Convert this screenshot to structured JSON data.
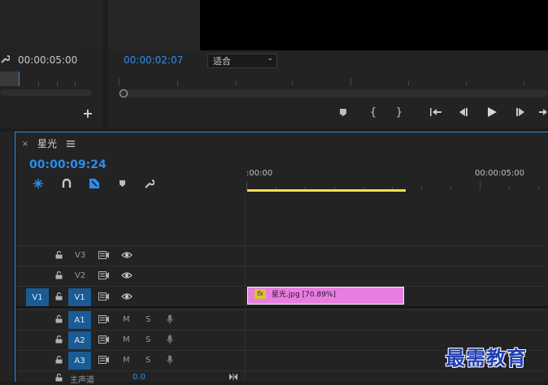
{
  "source_monitor": {
    "timecode": "00:00:05:00",
    "add_icon": "plus-icon"
  },
  "program_monitor": {
    "timecode": "00:00:02:07",
    "fit_label": "适合"
  },
  "sequence": {
    "tab_name": "星光",
    "timecode": "00:00:09:24",
    "ruler": {
      "start": ":00:00",
      "mark": "00:00:05:00"
    },
    "work_area_color": "#f2e14b"
  },
  "tracks": {
    "v3": {
      "name": "V3"
    },
    "v2": {
      "name": "V2"
    },
    "v1": {
      "source": "V1",
      "name": "V1"
    },
    "a1": {
      "name": "A1",
      "m": "M",
      "s": "S"
    },
    "a2": {
      "name": "A2",
      "m": "M",
      "s": "S"
    },
    "a3": {
      "name": "A3",
      "m": "M",
      "s": "S"
    },
    "master": {
      "name": "主声道",
      "value": "0.0"
    }
  },
  "clip": {
    "fx": "fx",
    "label": "星光.jpg [70.89%]",
    "color": "#e77fe1"
  },
  "watermark": "最需教育"
}
